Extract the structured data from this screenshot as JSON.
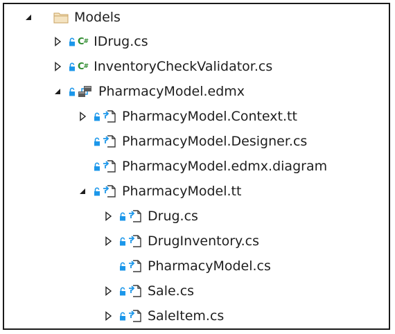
{
  "tree": {
    "items": [
      {
        "label": "Models",
        "type": "folder",
        "expander": "expanded",
        "source_control": false
      },
      {
        "label": "IDrug.cs",
        "type": "csharp",
        "expander": "collapsed",
        "source_control": true
      },
      {
        "label": "InventoryCheckValidator.cs",
        "type": "csharp",
        "expander": "collapsed",
        "source_control": true
      },
      {
        "label": "PharmacyModel.edmx",
        "type": "edmx",
        "expander": "expanded",
        "source_control": true
      },
      {
        "label": "PharmacyModel.Context.tt",
        "type": "template",
        "expander": "collapsed",
        "source_control": true
      },
      {
        "label": "PharmacyModel.Designer.cs",
        "type": "template",
        "expander": "none",
        "source_control": true
      },
      {
        "label": "PharmacyModel.edmx.diagram",
        "type": "template",
        "expander": "none",
        "source_control": true
      },
      {
        "label": "PharmacyModel.tt",
        "type": "template",
        "expander": "expanded",
        "source_control": true
      },
      {
        "label": "Drug.cs",
        "type": "template",
        "expander": "collapsed",
        "source_control": true
      },
      {
        "label": "DrugInventory.cs",
        "type": "template",
        "expander": "collapsed",
        "source_control": true
      },
      {
        "label": "PharmacyModel.cs",
        "type": "template",
        "expander": "none",
        "source_control": true
      },
      {
        "label": "Sale.cs",
        "type": "template",
        "expander": "collapsed",
        "source_control": true
      },
      {
        "label": "SaleItem.cs",
        "type": "template",
        "expander": "collapsed",
        "source_control": true
      }
    ]
  },
  "colors": {
    "text": "#1e1e1e",
    "csharp_icon": "#2e8b2e",
    "lock_icon": "#1c97ea",
    "template_arrow": "#1c97ea",
    "folder": "#dcb67a",
    "border": "#1a1a1a"
  }
}
